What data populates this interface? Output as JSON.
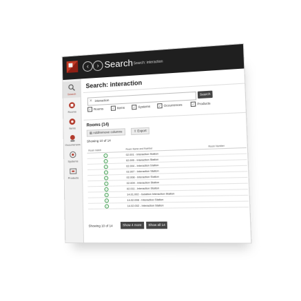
{
  "header": {
    "title": "Search",
    "breadcrumb": "Search: interaction",
    "back_icon": "chevron-left-icon",
    "forward_icon": "chevron-right-icon"
  },
  "sidebar": {
    "items": [
      {
        "label": "Search",
        "icon": "search-icon",
        "active": true
      },
      {
        "label": "Rooms",
        "icon": "rooms-icon",
        "active": false
      },
      {
        "label": "Items",
        "icon": "items-icon",
        "active": false
      },
      {
        "label": "Occurrences",
        "icon": "occurrences-icon",
        "active": false
      },
      {
        "label": "Systems",
        "icon": "systems-icon",
        "active": false
      },
      {
        "label": "Products",
        "icon": "products-icon",
        "active": false
      }
    ]
  },
  "main": {
    "heading": "Search: interaction",
    "search": {
      "value": "interaction",
      "button_label": "Search"
    },
    "filters": [
      {
        "label": "Rooms",
        "checked": true
      },
      {
        "label": "Items",
        "checked": true
      },
      {
        "label": "Systems",
        "checked": true
      },
      {
        "label": "Occurrences",
        "checked": true
      },
      {
        "label": "Products",
        "checked": true
      }
    ],
    "section_title": "Rooms (14)",
    "toolbar": {
      "add_remove_label": "Add/remove columns",
      "export_label": "Export"
    },
    "showing_top": "Showing 10 of 14",
    "table": {
      "columns": [
        "Room match",
        "Room Name and Number",
        "Room Number"
      ],
      "rows": [
        {
          "name": "02.001 - Interaction Station"
        },
        {
          "name": "02.005 - Interaction Station"
        },
        {
          "name": "02.004 - Interaction Station"
        },
        {
          "name": "02.007 - Interaction Station"
        },
        {
          "name": "02.008 - Interaction Station"
        },
        {
          "name": "02.009 - Interaction Station"
        },
        {
          "name": "02.011 - Interaction Station"
        },
        {
          "name": "14.01.002 - Isolation Interaction Station"
        },
        {
          "name": "14.02.008 - Interaction Station"
        },
        {
          "name": "14.02.002 - Interaction Station"
        }
      ]
    },
    "showing_bottom": "Showing 10 of 14",
    "show_more_label": "Show 4 more",
    "show_all_label": "Show all 14"
  },
  "colors": {
    "accent": "#b23a2c",
    "topbar": "#1f1f1f",
    "ok": "#3a9b4b"
  }
}
